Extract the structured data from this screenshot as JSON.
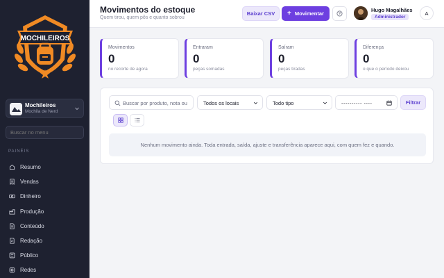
{
  "sidebar": {
    "logo_text": "MOCHILEIROS",
    "brand": {
      "name": "Mochileiros",
      "subtitle": "Mochila de Nerd"
    },
    "search_placeholder": "Buscar no menu",
    "section_label": "PAINÉIS",
    "items": [
      {
        "label": "Resumo",
        "icon": "home-icon"
      },
      {
        "label": "Vendas",
        "icon": "receipt-icon"
      },
      {
        "label": "Dinheiro",
        "icon": "money-icon"
      },
      {
        "label": "Produção",
        "icon": "factory-icon"
      },
      {
        "label": "Conteúdo",
        "icon": "document-icon"
      },
      {
        "label": "Redação",
        "icon": "pen-icon"
      },
      {
        "label": "Público",
        "icon": "users-icon"
      },
      {
        "label": "Redes",
        "icon": "instagram-icon"
      }
    ]
  },
  "header": {
    "title": "Movimentos do estoque",
    "subtitle": "Quem tirou, quem pôs e quanto sobrou",
    "csv_label": "Baixar CSV",
    "move_label": "Movimentar",
    "user": {
      "name": "Hugo Magalhães",
      "role": "Administrador",
      "initial": "A"
    }
  },
  "stats": [
    {
      "label": "Movimentos",
      "value": "0",
      "note": "no recorte de agora"
    },
    {
      "label": "Entraram",
      "value": "0",
      "note": "peças somadas"
    },
    {
      "label": "Saíram",
      "value": "0",
      "note": "peças tiradas"
    },
    {
      "label": "Diferença",
      "value": "0",
      "note": "o que o período deixou"
    }
  ],
  "filters": {
    "search_placeholder": "Buscar por produto, nota ou",
    "location": "Todos os locais",
    "type": "Todo tipo",
    "date": "---------- ----",
    "filter_label": "Filtrar"
  },
  "empty_message": "Nenhum movimento ainda. Toda entrada, saída, ajuste e transferência aparece aqui, com quem fez e quando.",
  "colors": {
    "accent": "#6d3fe0",
    "sidebar": "#1e2130",
    "logo_orange": "#f08a24"
  }
}
